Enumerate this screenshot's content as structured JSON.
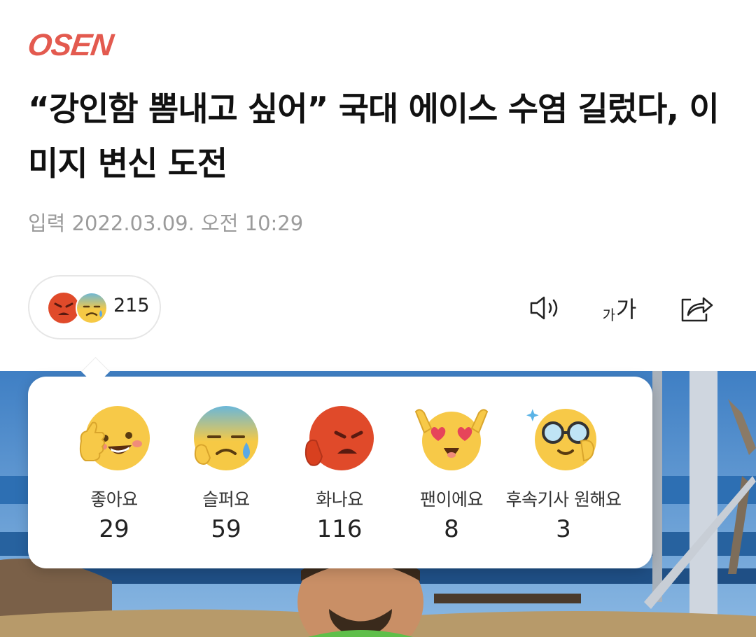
{
  "header": {
    "logo_text": "OSEN",
    "logo_color": "#e35a4f"
  },
  "article": {
    "title": "“강인함 뽐내고 싶어” 국대 에이스 수염 길렀다, 이미지 변신 도전",
    "date": "입력 2022.03.09. 오전 10:29"
  },
  "reaction_summary": {
    "icons": [
      "angry-face-icon",
      "sad-face-icon"
    ],
    "total": "215"
  },
  "toolbar": {
    "icons": [
      "speaker-icon",
      "font-size-icon",
      "share-icon"
    ],
    "font_small": "가",
    "font_large": "가"
  },
  "reactions": [
    {
      "icon": "thumbs-up-face-icon",
      "label": "좋아요",
      "count": "29"
    },
    {
      "icon": "sad-face-icon",
      "label": "슬퍼요",
      "count": "59"
    },
    {
      "icon": "angry-face-icon",
      "label": "화나요",
      "count": "116"
    },
    {
      "icon": "heart-eyes-face-icon",
      "label": "팬이에요",
      "count": "8"
    },
    {
      "icon": "glasses-face-icon",
      "label": "후속기사 원해요",
      "count": "3"
    }
  ]
}
